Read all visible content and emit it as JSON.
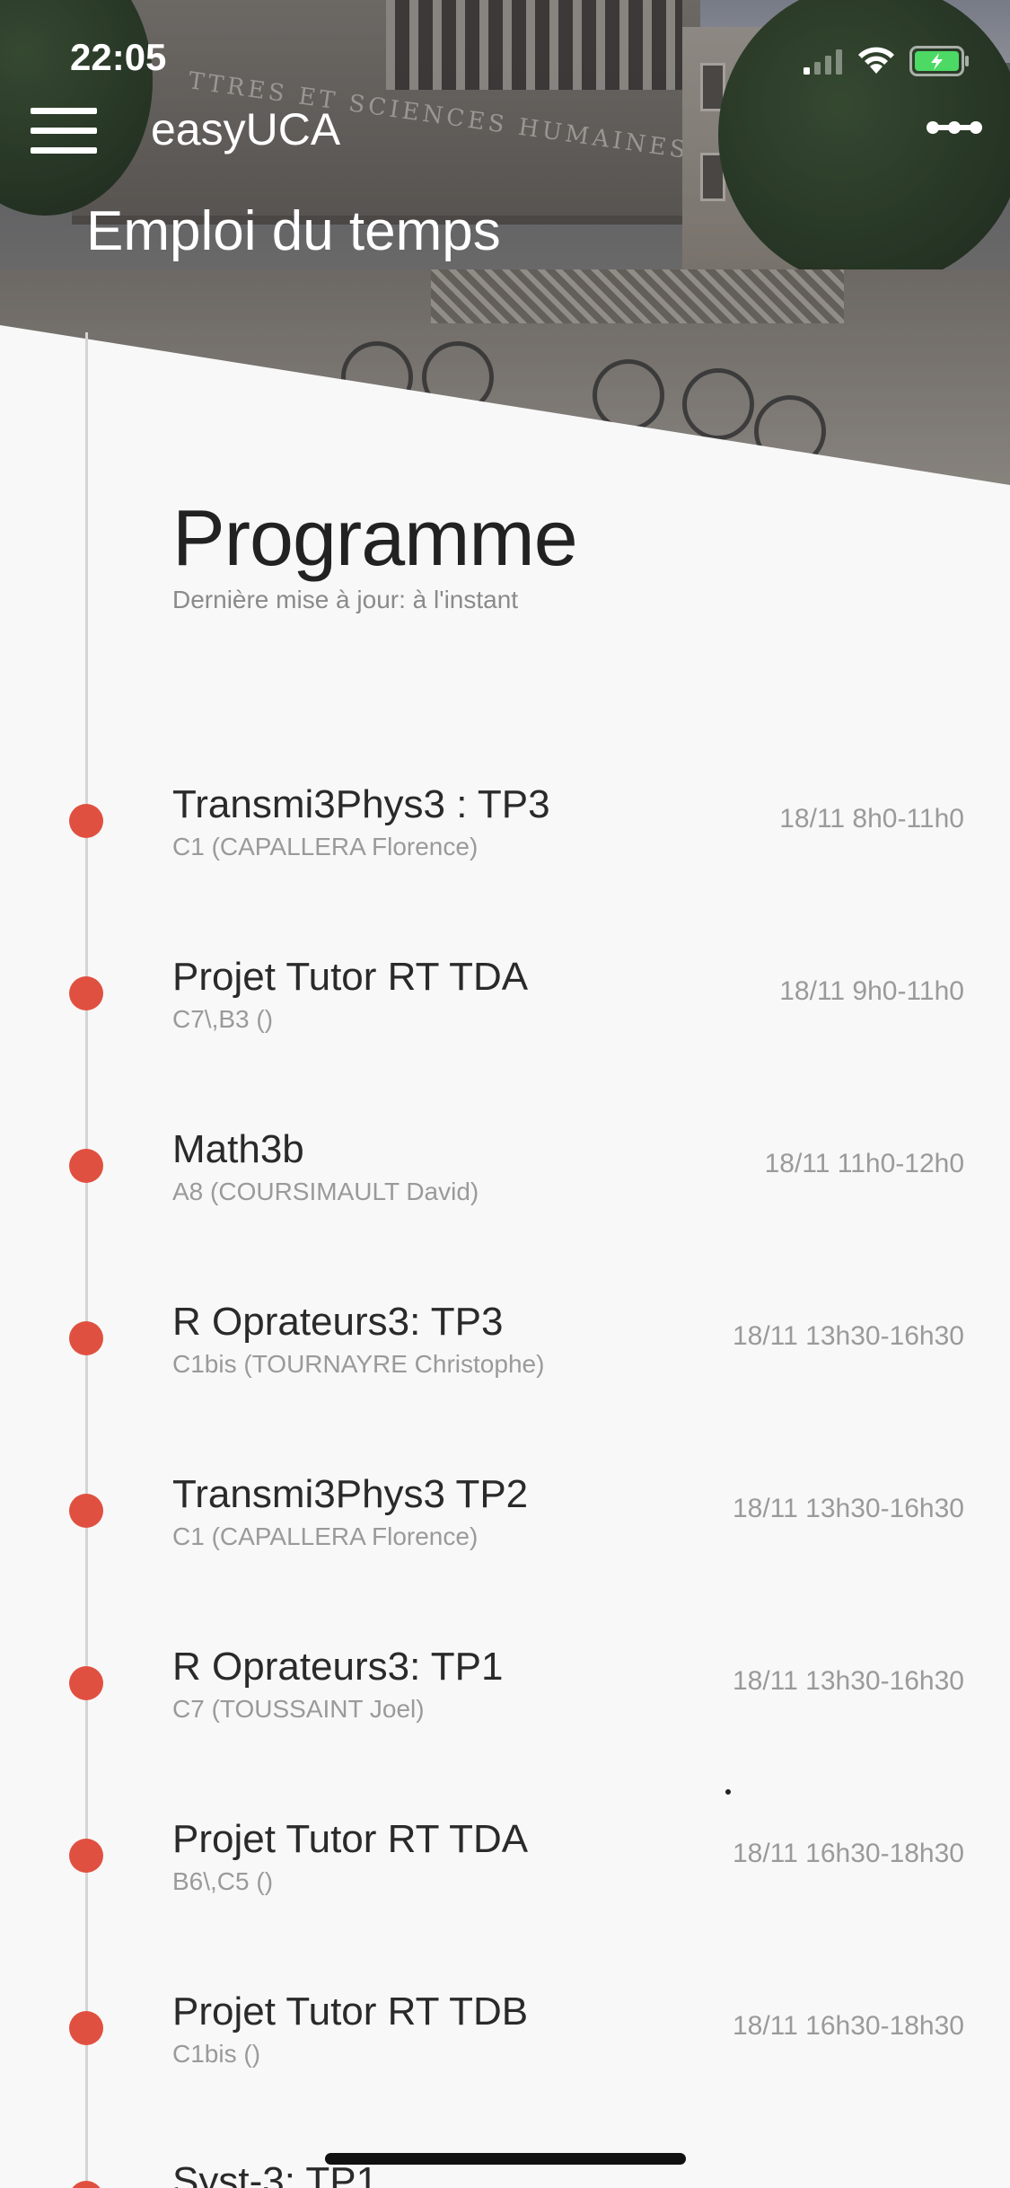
{
  "status_bar": {
    "time": "22:05",
    "icons": [
      "signal-icon",
      "wifi-icon",
      "battery-charging-icon"
    ]
  },
  "nav": {
    "app_title": "easyUCA",
    "page_title": "Emploi du temps",
    "menu_icon": "hamburger-menu-icon",
    "more_icon": "more-options-icon"
  },
  "header_photo": {
    "carved_text": "TTRES ET SCIENCES HUMAINES"
  },
  "section": {
    "title": "Programme",
    "subtitle": "Dernière mise à jour: à l'instant"
  },
  "colors": {
    "accent_dot": "#e05040",
    "background": "#f8f8f8",
    "timeline": "#d4d4d4"
  },
  "events": [
    {
      "title": "Transmi3Phys3 : TP3",
      "subtitle": "C1 (CAPALLERA Florence)",
      "time": "18/11 8h0-11h0"
    },
    {
      "title": "Projet Tutor RT TDA",
      "subtitle": "C7\\,B3 ()",
      "time": "18/11 9h0-11h0"
    },
    {
      "title": "Math3b",
      "subtitle": "A8 (COURSIMAULT David)",
      "time": "18/11 11h0-12h0"
    },
    {
      "title": "R Oprateurs3: TP3",
      "subtitle": "C1bis (TOURNAYRE Christophe)",
      "time": "18/11 13h30-16h30"
    },
    {
      "title": "Transmi3Phys3 TP2",
      "subtitle": "C1 (CAPALLERA Florence)",
      "time": "18/11 13h30-16h30"
    },
    {
      "title": "R Oprateurs3: TP1",
      "subtitle": "C7 (TOUSSAINT Joel)",
      "time": "18/11 13h30-16h30"
    },
    {
      "title": "Projet Tutor RT TDA",
      "subtitle": "B6\\,C5 ()",
      "time": "18/11 16h30-18h30"
    },
    {
      "title": "Projet Tutor RT TDB",
      "subtitle": "C1bis ()",
      "time": "18/11 16h30-18h30"
    },
    {
      "title": "Syst-3: TP1",
      "subtitle": "",
      "time": ""
    }
  ]
}
